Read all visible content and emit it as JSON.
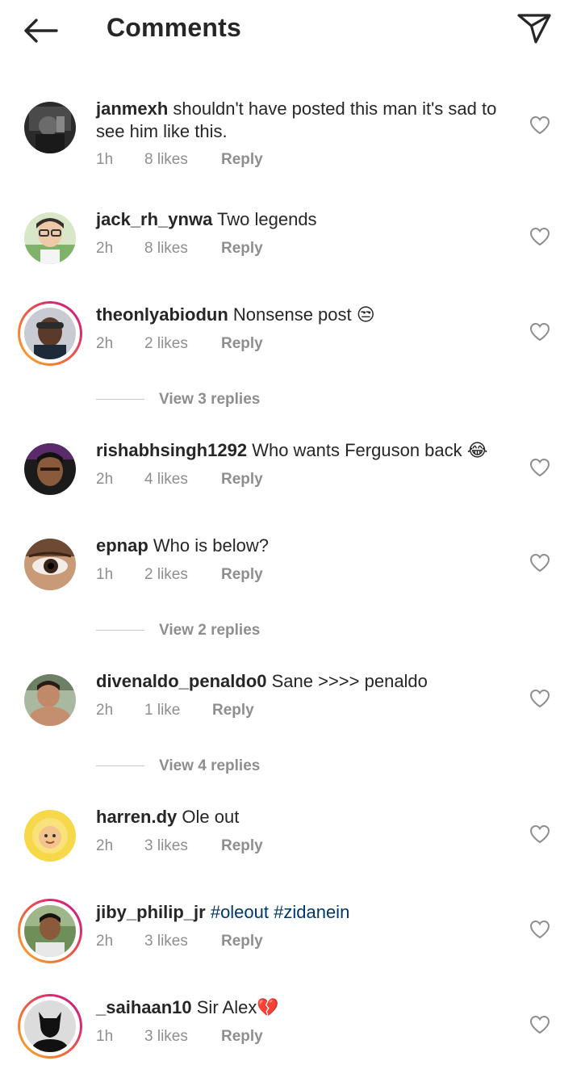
{
  "header": {
    "title": "Comments",
    "back_icon": "arrow-left-icon",
    "share_icon": "paper-plane-icon"
  },
  "comments": [
    {
      "username": "janmexh",
      "text": " shouldn't have posted this man it's sad to see him like this.",
      "time": "1h",
      "likes": "8 likes",
      "reply": "Reply"
    },
    {
      "username": "jack_rh_ynwa",
      "text": " Two legends",
      "time": "2h",
      "likes": "8 likes",
      "reply": "Reply"
    },
    {
      "username": "theonlyabiodun",
      "text": " Nonsense post 😒",
      "time": "2h",
      "likes": "2 likes",
      "reply": "Reply",
      "view_replies": "View 3 replies"
    },
    {
      "username": "rishabhsingh1292",
      "text": " Who wants Ferguson back 😂",
      "time": "2h",
      "likes": "4 likes",
      "reply": "Reply"
    },
    {
      "username": "epnap",
      "text": " Who is below?",
      "time": "1h",
      "likes": "2 likes",
      "reply": "Reply",
      "view_replies": "View 2 replies"
    },
    {
      "username": "divenaldo_penaldo0",
      "text": " Sane >>>> penaldo",
      "time": "2h",
      "likes": "1 like",
      "reply": "Reply",
      "view_replies": "View 4 replies"
    },
    {
      "username": "harren.dy",
      "text": " Ole out",
      "time": "2h",
      "likes": "3 likes",
      "reply": "Reply"
    },
    {
      "username": "jiby_philip_jr",
      "text": " ",
      "hashtags": "#oleout #zidanein",
      "time": "2h",
      "likes": "3 likes",
      "reply": "Reply"
    },
    {
      "username": "_saihaan10",
      "text": " Sir Alex💔",
      "time": "1h",
      "likes": "3 likes",
      "reply": "Reply"
    }
  ],
  "colors": {
    "text": "#262626",
    "secondary": "#8e8e8e",
    "hashtag": "#00376b",
    "story_ring_start": "#f7b32b",
    "story_ring_end": "#bf1e8a"
  }
}
